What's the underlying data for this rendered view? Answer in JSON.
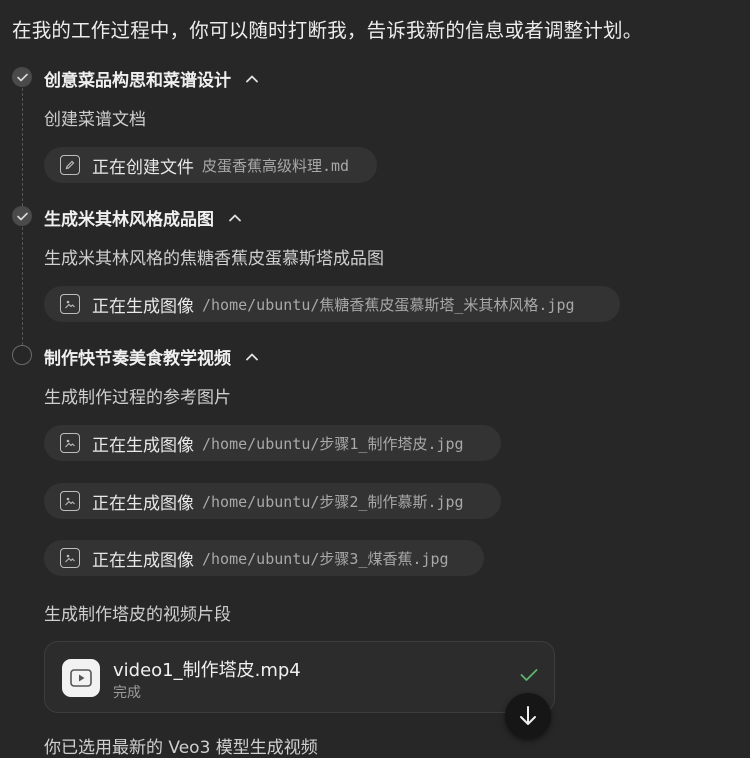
{
  "intro": "在我的工作过程中，你可以随时打断我，告诉我新的信息或者调整计划。",
  "steps": [
    {
      "title": "创意菜品构思和菜谱设计",
      "status": "done",
      "subtitle": "创建菜谱文档",
      "actions": [
        {
          "icon": "edit-icon",
          "action": "正在创建文件",
          "target": "皮蛋香蕉高级料理.md"
        }
      ]
    },
    {
      "title": "生成米其林风格成品图",
      "status": "done",
      "subtitle": "生成米其林风格的焦糖香蕉皮蛋慕斯塔成品图",
      "actions": [
        {
          "icon": "image-icon",
          "action": "正在生成图像",
          "target": "/home/ubuntu/焦糖香蕉皮蛋慕斯塔_米其林风格.jpg"
        }
      ]
    },
    {
      "title": "制作快节奏美食教学视频",
      "status": "pending",
      "subtitle": "生成制作过程的参考图片",
      "actions": [
        {
          "icon": "image-icon",
          "action": "正在生成图像",
          "target": "/home/ubuntu/步骤1_制作塔皮.jpg"
        },
        {
          "icon": "image-icon",
          "action": "正在生成图像",
          "target": "/home/ubuntu/步骤2_制作慕斯.jpg"
        },
        {
          "icon": "image-icon",
          "action": "正在生成图像",
          "target": "/home/ubuntu/步骤3_煤香蕉.jpg"
        }
      ],
      "subtitle2": "生成制作塔皮的视频片段",
      "video": {
        "filename": "video1_制作塔皮.mp4",
        "status": "完成"
      }
    }
  ],
  "footer": "你已选用最新的 Veo3 模型生成视频",
  "colors": {
    "background": "#272727",
    "pill": "#333333",
    "check": "#5fb36b"
  }
}
